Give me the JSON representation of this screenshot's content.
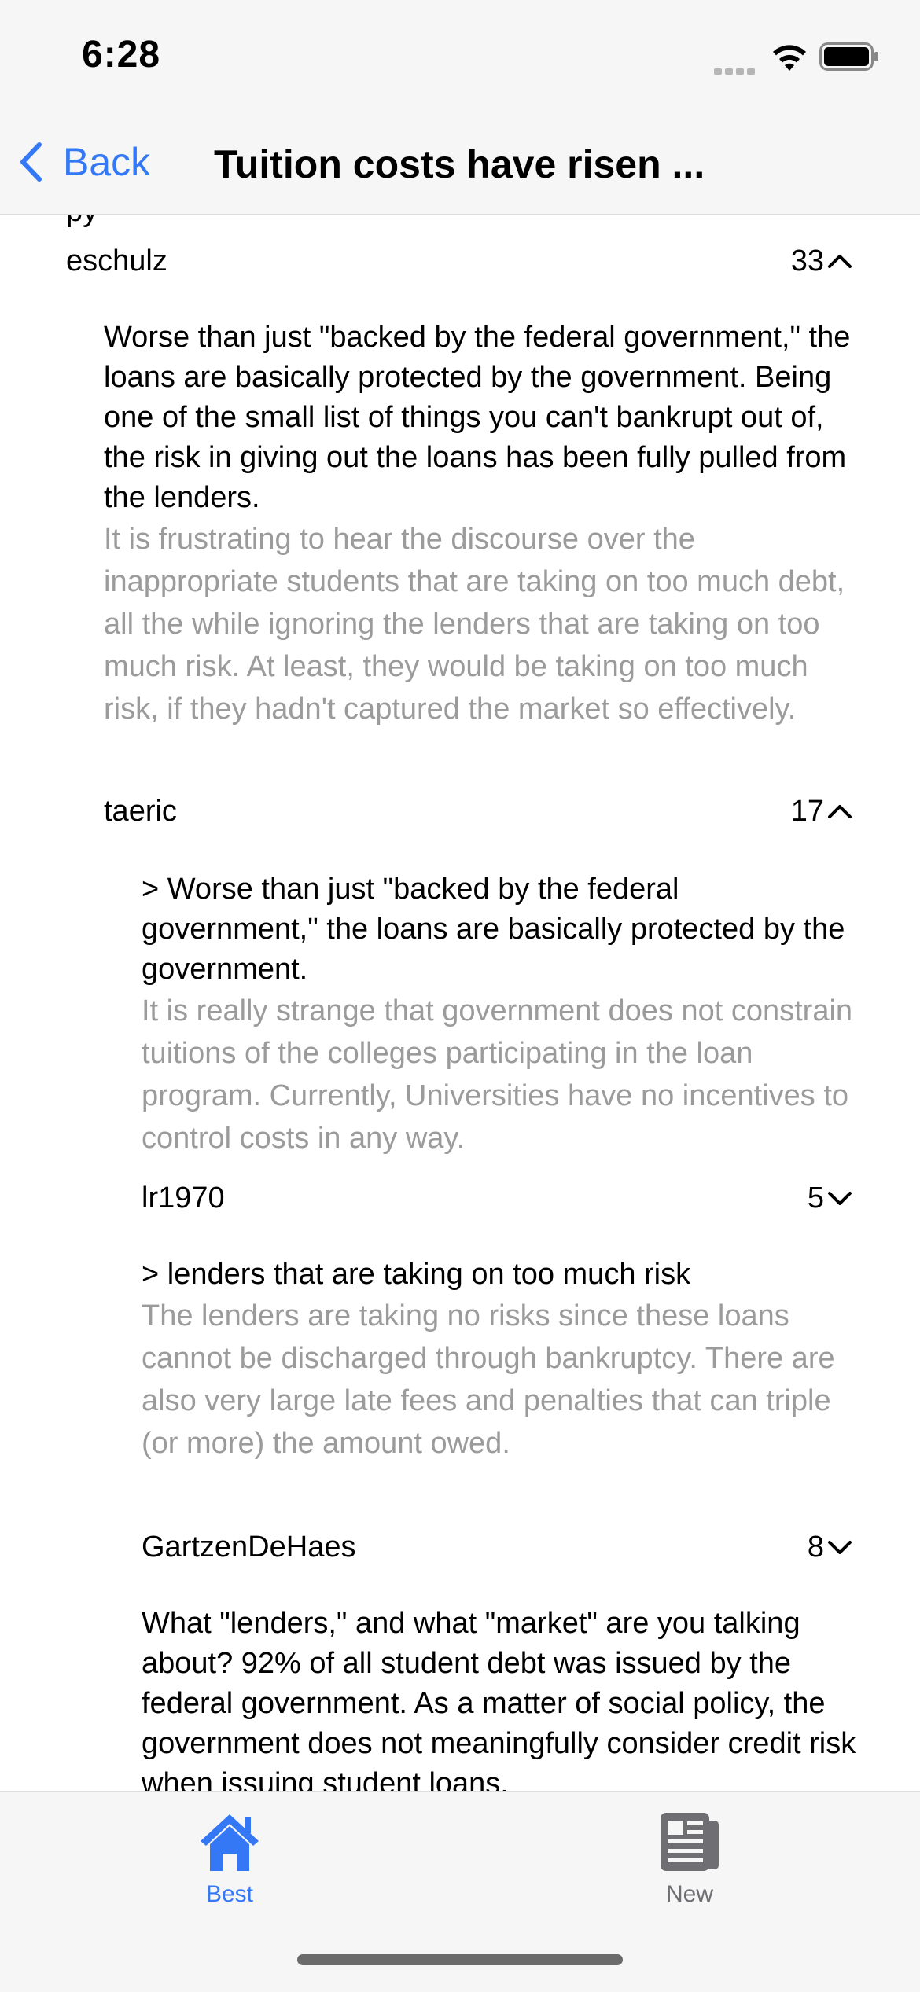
{
  "status": {
    "time": "6:28"
  },
  "nav": {
    "back_label": "Back",
    "title": "Tuition costs have risen ..."
  },
  "comments": [
    {
      "author": "eschulz",
      "score": "33",
      "chevron": "chevron-up",
      "quote": "Worse than just \"backed by the federal government,\" the loans are basically protected by the government. Being one of the small list of things you can't bankrupt out of, the risk in giving out the loans has been fully pulled from the lenders.",
      "reply": "It is frustrating to hear the discourse over the inappropriate students that are taking on too much debt, all the while ignoring the lenders that are taking on too much risk. At least, they would be taking on too much risk, if they hadn't captured the market so effectively."
    },
    {
      "author": "taeric",
      "score": "17",
      "chevron": "chevron-up",
      "quote": "> Worse than just \"backed by the federal government,\" the loans are basically protected by the government.",
      "reply": "It is really strange that government does not constrain tuitions of the colleges participating in the loan program. Currently, Universities have no incentives to control costs in any way."
    },
    {
      "author": "lr1970",
      "score": "5",
      "chevron": "chevron-down",
      "quote": "> lenders that are taking on too much risk",
      "reply": "The lenders are taking no risks since these loans cannot be discharged through bankruptcy. There are also very large late fees and penalties that can triple (or more) the amount owed."
    },
    {
      "author": "GartzenDeHaes",
      "score": "8",
      "chevron": "chevron-down",
      "quote": "What \"lenders,\" and what \"market\" are you talking about? 92% of all student debt was issued by the federal government. As a matter of social policy, the government does not meaningfully consider credit risk when issuing student loans."
    }
  ],
  "tabs": {
    "best_label": "Best",
    "new_label": "New"
  },
  "colors": {
    "accent": "#3478f6",
    "muted_text": "#9b9b9b",
    "bar_bg": "#f6f6f6"
  }
}
